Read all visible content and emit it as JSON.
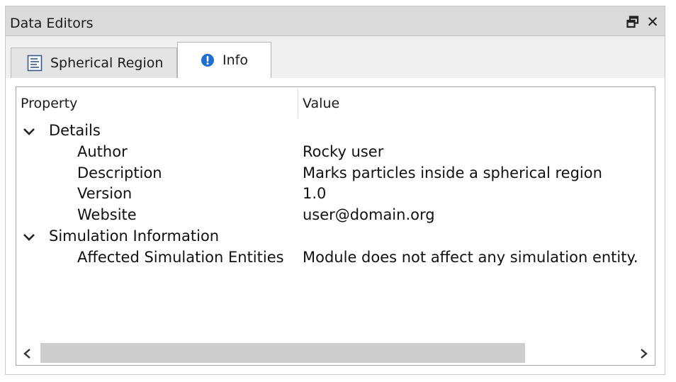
{
  "window": {
    "title": "Data Editors",
    "float_icon": "float-window-icon",
    "close_label": "✕"
  },
  "tabs": [
    {
      "label": "Spherical Region",
      "icon": "document-icon",
      "active": false
    },
    {
      "label": "Info",
      "icon": "info-icon",
      "active": true
    }
  ],
  "table": {
    "headers": {
      "property": "Property",
      "value": "Value"
    },
    "groups": [
      {
        "label": "Details",
        "expanded": true,
        "rows": [
          {
            "property": "Author",
            "value": "Rocky user"
          },
          {
            "property": "Description",
            "value": "Marks particles inside a spherical region"
          },
          {
            "property": "Version",
            "value": "1.0"
          },
          {
            "property": "Website",
            "value": "user@domain.org"
          }
        ]
      },
      {
        "label": "Simulation Information",
        "expanded": true,
        "rows": [
          {
            "property": "Affected Simulation Entities",
            "value": "Module does not affect any simulation entity."
          }
        ]
      }
    ]
  },
  "colors": {
    "info_blue": "#1f6fd0",
    "titlebar_bg": "#dadada",
    "panel_bg": "#f0f0f0"
  }
}
